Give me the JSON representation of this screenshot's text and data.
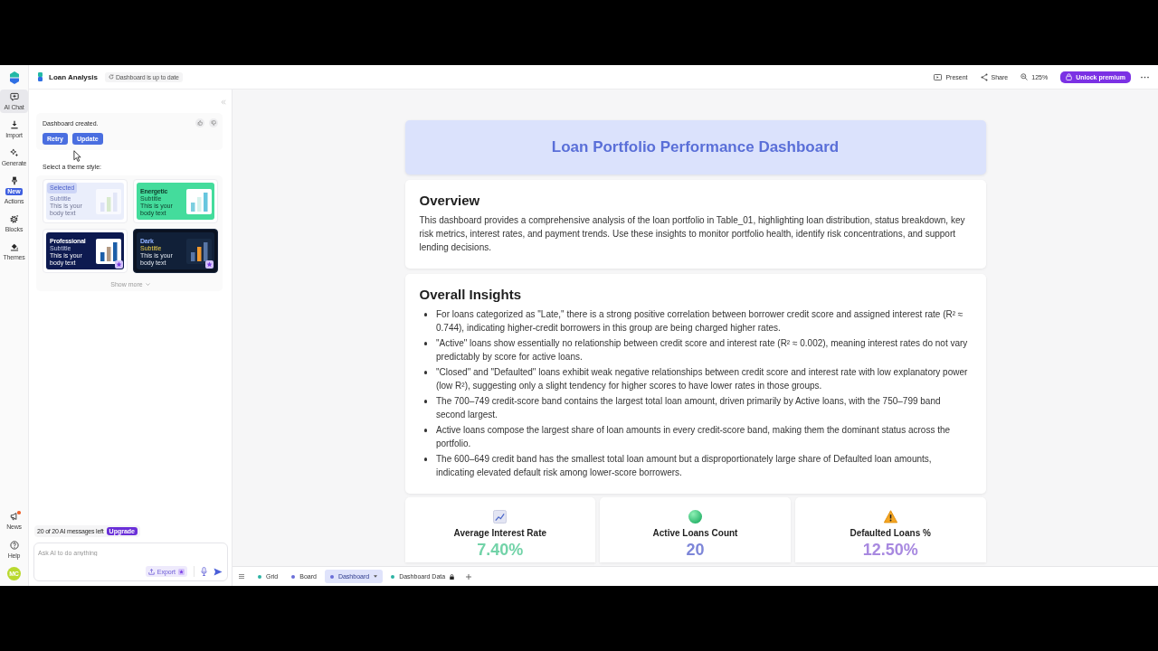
{
  "window": {
    "title": "Loan Analysis",
    "status": "Dashboard is up to date"
  },
  "rail": {
    "items": [
      {
        "label": "AI Chat",
        "kind": "chat",
        "selected": true
      },
      {
        "label": "Import",
        "kind": "import",
        "selected": false
      },
      {
        "label": "Generate",
        "kind": "generate",
        "selected": false
      },
      {
        "label": "Actions",
        "kind": "actions",
        "selected": false,
        "badge": "New"
      },
      {
        "label": "Blocks",
        "kind": "blocks",
        "selected": false
      },
      {
        "label": "Themes",
        "kind": "themes",
        "selected": false
      }
    ],
    "footer": [
      {
        "label": "News",
        "kind": "news",
        "unread": true
      },
      {
        "label": "Help",
        "kind": "help",
        "unread": false
      }
    ],
    "avatar": "MC"
  },
  "toolbar": {
    "present": "Present",
    "share": "Share",
    "zoom": "125%",
    "premium": "Unlock premium"
  },
  "chat": {
    "message": "Dashboard created.",
    "actions": [
      "Retry",
      "Update"
    ],
    "prompt": "Select a theme style:",
    "themes": [
      {
        "kind": "light",
        "selected": true,
        "tag": "Selected",
        "subtitle": "Subtitle",
        "body": "This is your body text",
        "premium": false
      },
      {
        "kind": "energetic",
        "name": "Energetic",
        "subtitle": "Subtitle",
        "body": "This is your body text",
        "selected": false,
        "premium": false
      },
      {
        "kind": "professional",
        "name": "Professional",
        "subtitle": "Subtitle",
        "body": "This is your body text",
        "selected": false,
        "premium": true
      },
      {
        "kind": "dark",
        "name": "Dark",
        "subtitle": "Subtitle",
        "body": "This is your body text",
        "selected": false,
        "premium": true
      }
    ],
    "show_more": "Show more",
    "quota": "20 of 20 AI messages left",
    "upgrade": "Upgrade",
    "input": {
      "placeholder": "Ask AI to do anything"
    },
    "export": {
      "label": "Export",
      "premium": true
    }
  },
  "dashboard": {
    "title": "Loan Portfolio Performance Dashboard",
    "sections": [
      {
        "heading": "Overview",
        "text": "This dashboard provides a comprehensive analysis of the loan portfolio in Table_01, highlighting loan distribution, status breakdown, key risk metrics, interest rates, and payment trends. Use these insights to monitor portfolio health, identify risk concentrations, and support lending decisions."
      },
      {
        "heading": "Overall Insights",
        "bullets": [
          "For loans categorized as \"Late,\" there is a strong positive correlation between borrower credit score and assigned interest rate (R² ≈ 0.744), indicating higher-credit borrowers in this group are being charged higher rates.",
          "\"Active\" loans show essentially no relationship between credit score and interest rate (R² ≈ 0.002), meaning interest rates do not vary predictably by score for active loans.",
          "\"Closed\" and \"Defaulted\" loans exhibit weak negative relationships between credit score and interest rate with low explanatory power (low R²), suggesting only a slight tendency for higher scores to have lower rates in those groups.",
          "The 700–749 credit-score band contains the largest total loan amount, driven primarily by Active loans, with the 750–799 band second largest.",
          "Active loans compose the largest share of loan amounts in every credit-score band, making them the dominant status across the portfolio.",
          "The 600–649 credit band has the smallest total loan amount but a disproportionately large share of Defaulted loan amounts, indicating elevated default risk among lower-score borrowers."
        ]
      }
    ],
    "kpis": [
      {
        "kind": "chart",
        "title": "Average Interest Rate",
        "value": "7.40%",
        "color": "#72d3a8"
      },
      {
        "kind": "dot",
        "title": "Active Loans Count",
        "value": "20",
        "color": "#7d86d8"
      },
      {
        "kind": "warning",
        "title": "Defaulted Loans %",
        "value": "12.50%",
        "color": "#a889e0"
      }
    ]
  },
  "sheet": {
    "tabs": [
      {
        "label": "Grid",
        "color": "#2bb3a3",
        "selected": false,
        "locked": false
      },
      {
        "label": "Board",
        "color": "#6a6ed8",
        "selected": false,
        "locked": false
      },
      {
        "label": "Dashboard",
        "color": "#6a6ed8",
        "selected": true,
        "locked": false
      },
      {
        "label": "Dashboard Data",
        "color": "#2bb3a3",
        "selected": false,
        "locked": true
      }
    ]
  }
}
